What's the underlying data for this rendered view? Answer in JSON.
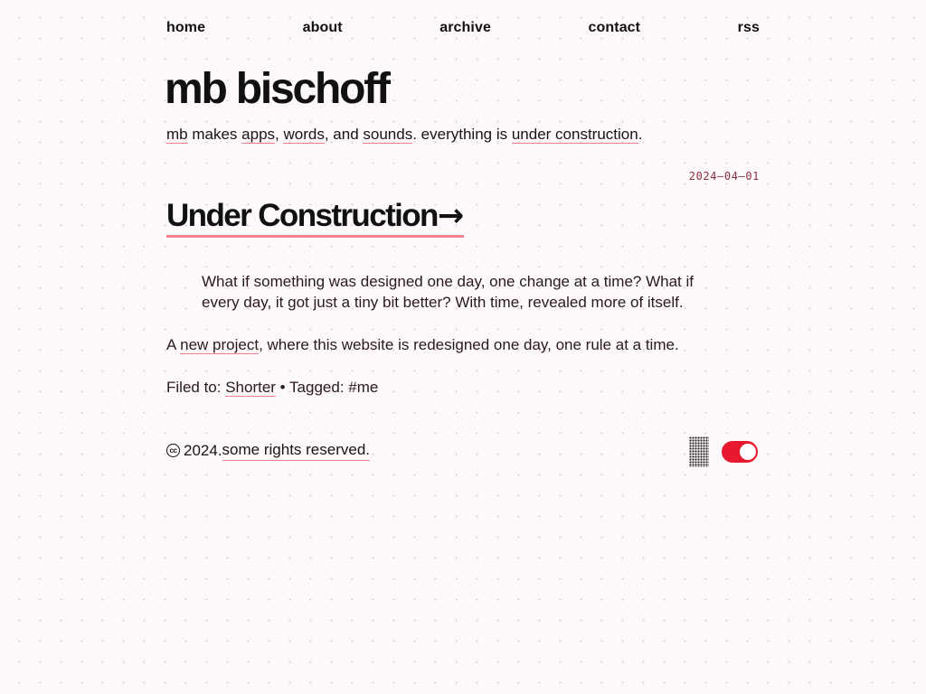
{
  "nav": {
    "home": "home",
    "about": "about",
    "archive": "archive",
    "contact": "contact",
    "rss": "rss"
  },
  "site": {
    "title": "mb bischoff",
    "tagline": {
      "link_mb": "mb",
      "text1": " makes ",
      "link_apps": "apps",
      "text2": ", ",
      "link_words": "words",
      "text3": ", and ",
      "link_sounds": "sounds",
      "text4": ". everything is ",
      "link_under_construction": "under construction",
      "text5": "."
    }
  },
  "post": {
    "date": "2024–04–01",
    "title": "Under Construction",
    "arrow": "→",
    "quote": "What if something was designed one day, one change at a time? What if every day, it got just a tiny bit better? With time, revealed more of itself.",
    "body": {
      "text1": "A ",
      "link_new_project": "new project",
      "text2": ", where this website is redesigned one day, one rule at a time."
    },
    "meta": {
      "filed_label": "Filed to: ",
      "category": "Shorter",
      "separator": " • ",
      "tagged_label": "Tagged: ",
      "tag": "#me"
    }
  },
  "footer": {
    "cc_icon_text": "cc",
    "year_text": " 2024. ",
    "rights_link": "some rights reserved."
  },
  "controls": {
    "pattern_icon": "dither-pattern-icon",
    "toggle_state": "on",
    "toggle_color": "#e8192f"
  },
  "colors": {
    "background": "#fdf8f9",
    "underline": "#f07f92",
    "date": "#8a2f43",
    "text": "#1a1213"
  }
}
